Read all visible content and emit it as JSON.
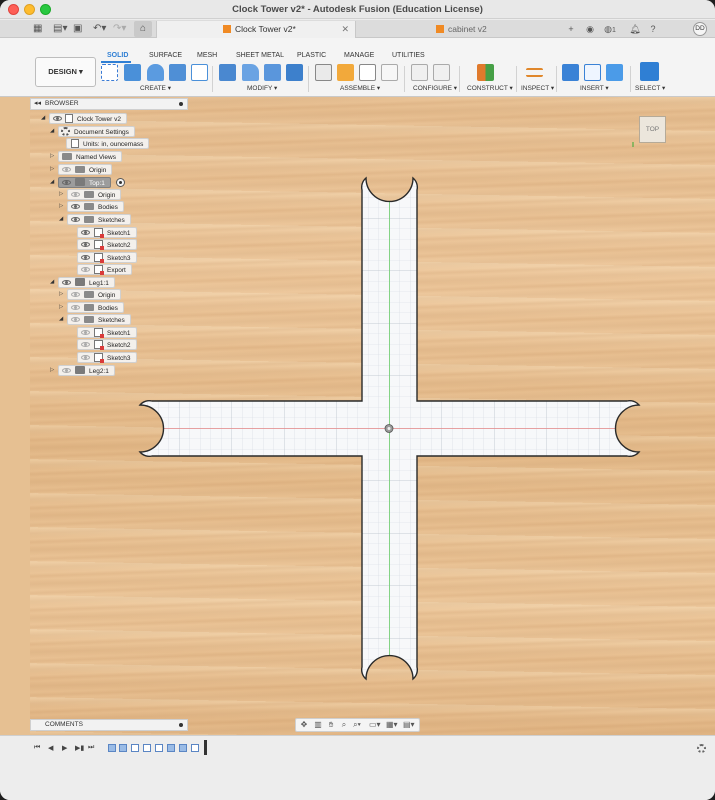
{
  "window": {
    "title": "Clock Tower v2* - Autodesk Fusion (Education License)"
  },
  "tabs": {
    "active": {
      "label": "Clock Tower v2*"
    },
    "inactive": {
      "label": "cabinet v2"
    },
    "notification_count": "1",
    "user_initials": "DD"
  },
  "ribbon": {
    "workspace": "DESIGN ▾",
    "tabs": [
      "SOLID",
      "SURFACE",
      "MESH",
      "SHEET METAL",
      "PLASTIC",
      "MANAGE",
      "UTILITIES"
    ],
    "active_tab": "SOLID",
    "groups": [
      "CREATE ▾",
      "MODIFY ▾",
      "ASSEMBLE ▾",
      "CONFIGURE ▾",
      "CONSTRUCT ▾",
      "INSPECT ▾",
      "INSERT ▾",
      "SELECT ▾"
    ],
    "accent": "#2f7fd4"
  },
  "browser": {
    "title": "BROWSER",
    "rows": [
      {
        "label": "Clock Tower v2"
      },
      {
        "label": "Document Settings"
      },
      {
        "label": "Units: in, ouncemass"
      },
      {
        "label": "Named Views"
      },
      {
        "label": "Origin"
      },
      {
        "label": "Top:1"
      },
      {
        "label": "Origin"
      },
      {
        "label": "Bodies"
      },
      {
        "label": "Sketches"
      },
      {
        "label": "Sketch1"
      },
      {
        "label": "Sketch2"
      },
      {
        "label": "Sketch3"
      },
      {
        "label": "Export"
      },
      {
        "label": "Leg1:1"
      },
      {
        "label": "Origin"
      },
      {
        "label": "Bodies"
      },
      {
        "label": "Sketches"
      },
      {
        "label": "Sketch1"
      },
      {
        "label": "Sketch2"
      },
      {
        "label": "Sketch3"
      },
      {
        "label": "Leg2:1"
      }
    ]
  },
  "viewcube": {
    "face": "TOP"
  },
  "comments": {
    "title": "COMMENTS"
  }
}
